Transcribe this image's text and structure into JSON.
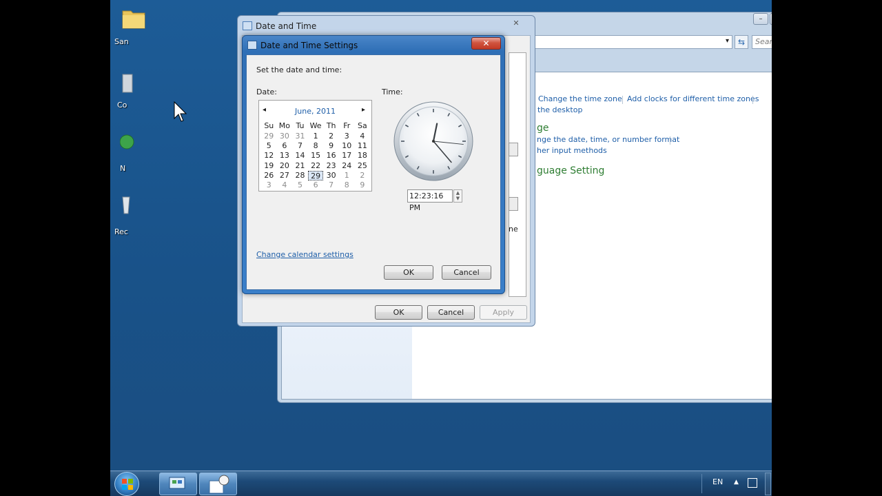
{
  "desktop": {
    "icons": [
      {
        "label": "San"
      },
      {
        "label": "Co"
      },
      {
        "label": "N"
      },
      {
        "label": "Rec"
      }
    ]
  },
  "control_panel": {
    "search_placeholder": "Search Con...",
    "links": {
      "change_time_zone": "Change the time zone",
      "add_clocks": "Add clocks for different time zones",
      "the_desktop": "the desktop",
      "region_heading": "ge",
      "change_format": "nge the date, time, or number format",
      "input_methods": "her input methods",
      "language_heading": "guage Setting"
    },
    "partial_text": "ne"
  },
  "date_time_dialog": {
    "title": "Date and Time",
    "buttons": {
      "ok": "OK",
      "cancel": "Cancel",
      "apply": "Apply"
    }
  },
  "settings_dialog": {
    "title": "Date and Time Settings",
    "close_glyph": "✕",
    "instruction": "Set the date and time:",
    "date_label": "Date:",
    "time_label": "Time:",
    "calendar": {
      "month_label": "June, 2011",
      "prev_glyph": "◂",
      "next_glyph": "▸",
      "weekdays": [
        "Su",
        "Mo",
        "Tu",
        "We",
        "Th",
        "Fr",
        "Sa"
      ],
      "weeks": [
        [
          "29",
          "30",
          "31",
          "1",
          "2",
          "3",
          "4"
        ],
        [
          "5",
          "6",
          "7",
          "8",
          "9",
          "10",
          "11"
        ],
        [
          "12",
          "13",
          "14",
          "15",
          "16",
          "17",
          "18"
        ],
        [
          "19",
          "20",
          "21",
          "22",
          "23",
          "24",
          "25"
        ],
        [
          "26",
          "27",
          "28",
          "29",
          "30",
          "1",
          "2"
        ],
        [
          "3",
          "4",
          "5",
          "6",
          "7",
          "8",
          "9"
        ]
      ],
      "selected_day": "29"
    },
    "time_value": "12:23:16 PM",
    "change_calendar_link": "Change calendar settings",
    "buttons": {
      "ok": "OK",
      "cancel": "Cancel"
    }
  },
  "taskbar": {
    "language": "EN"
  }
}
